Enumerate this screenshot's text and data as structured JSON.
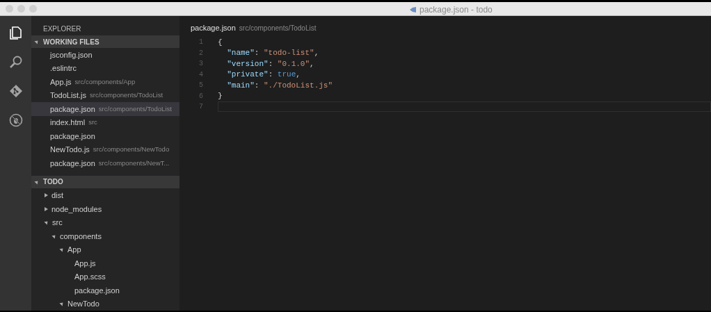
{
  "window": {
    "title": "package.json - todo"
  },
  "activity_bar": [
    {
      "kind": "files",
      "selected": true
    },
    {
      "kind": "search",
      "selected": false
    },
    {
      "kind": "git",
      "selected": false
    },
    {
      "kind": "debug",
      "selected": false
    }
  ],
  "sidebar": {
    "title": "EXPLORER",
    "working_files": {
      "label": "WORKING FILES",
      "expanded": true,
      "items": [
        {
          "name": "jsconfig.json",
          "selected": false
        },
        {
          "name": ".eslintrc",
          "selected": false
        },
        {
          "name": "App.js",
          "path": "src/components/App",
          "selected": false
        },
        {
          "name": "TodoList.js",
          "path": "src/components/TodoList",
          "selected": false
        },
        {
          "name": "package.json",
          "path": "src/components/TodoList",
          "selected": true
        },
        {
          "name": "index.html",
          "path": "src",
          "selected": false
        },
        {
          "name": "package.json",
          "selected": false
        },
        {
          "name": "NewTodo.js",
          "path": "src/components/NewTodo",
          "selected": false
        },
        {
          "name": "package.json",
          "path": "src/components/NewT...",
          "selected": false
        }
      ]
    },
    "folder": {
      "label": "TODO",
      "expanded": true,
      "children": [
        {
          "kind": "folder",
          "name": "dist",
          "expanded": false
        },
        {
          "kind": "folder",
          "name": "node_modules",
          "expanded": false
        },
        {
          "kind": "folder",
          "name": "src",
          "expanded": true,
          "children": [
            {
              "kind": "folder",
              "name": "components",
              "expanded": true,
              "children": [
                {
                  "kind": "folder",
                  "name": "App",
                  "expanded": true,
                  "children": [
                    {
                      "kind": "file",
                      "name": "App.js"
                    },
                    {
                      "kind": "file",
                      "name": "App.scss"
                    },
                    {
                      "kind": "file",
                      "name": "package.json"
                    }
                  ]
                },
                {
                  "kind": "folder",
                  "name": "NewTodo",
                  "expanded": true
                }
              ]
            }
          ]
        }
      ]
    }
  },
  "editor": {
    "file": "package.json",
    "path": "src/components/TodoList",
    "lines": [
      {
        "number": "1",
        "tokens": [
          {
            "kind": "punct",
            "text": "{"
          }
        ]
      },
      {
        "number": "2",
        "tokens": [
          {
            "kind": "key",
            "text": "  \"name\""
          },
          {
            "kind": "punct",
            "text": ": "
          },
          {
            "kind": "string",
            "text": "\"todo-list\""
          },
          {
            "kind": "punct",
            "text": ","
          }
        ]
      },
      {
        "number": "3",
        "tokens": [
          {
            "kind": "key",
            "text": "  \"version\""
          },
          {
            "kind": "punct",
            "text": ": "
          },
          {
            "kind": "string",
            "text": "\"0.1.0\""
          },
          {
            "kind": "punct",
            "text": ","
          }
        ]
      },
      {
        "number": "4",
        "tokens": [
          {
            "kind": "key",
            "text": "  \"private\""
          },
          {
            "kind": "punct",
            "text": ": "
          },
          {
            "kind": "bool",
            "text": "true"
          },
          {
            "kind": "punct",
            "text": ","
          }
        ]
      },
      {
        "number": "5",
        "tokens": [
          {
            "kind": "key",
            "text": "  \"main\""
          },
          {
            "kind": "punct",
            "text": ": "
          },
          {
            "kind": "string",
            "text": "\"./TodoList.js\""
          }
        ]
      },
      {
        "number": "6",
        "tokens": [
          {
            "kind": "punct",
            "text": "}"
          }
        ]
      },
      {
        "number": "7",
        "current": true
      }
    ]
  }
}
